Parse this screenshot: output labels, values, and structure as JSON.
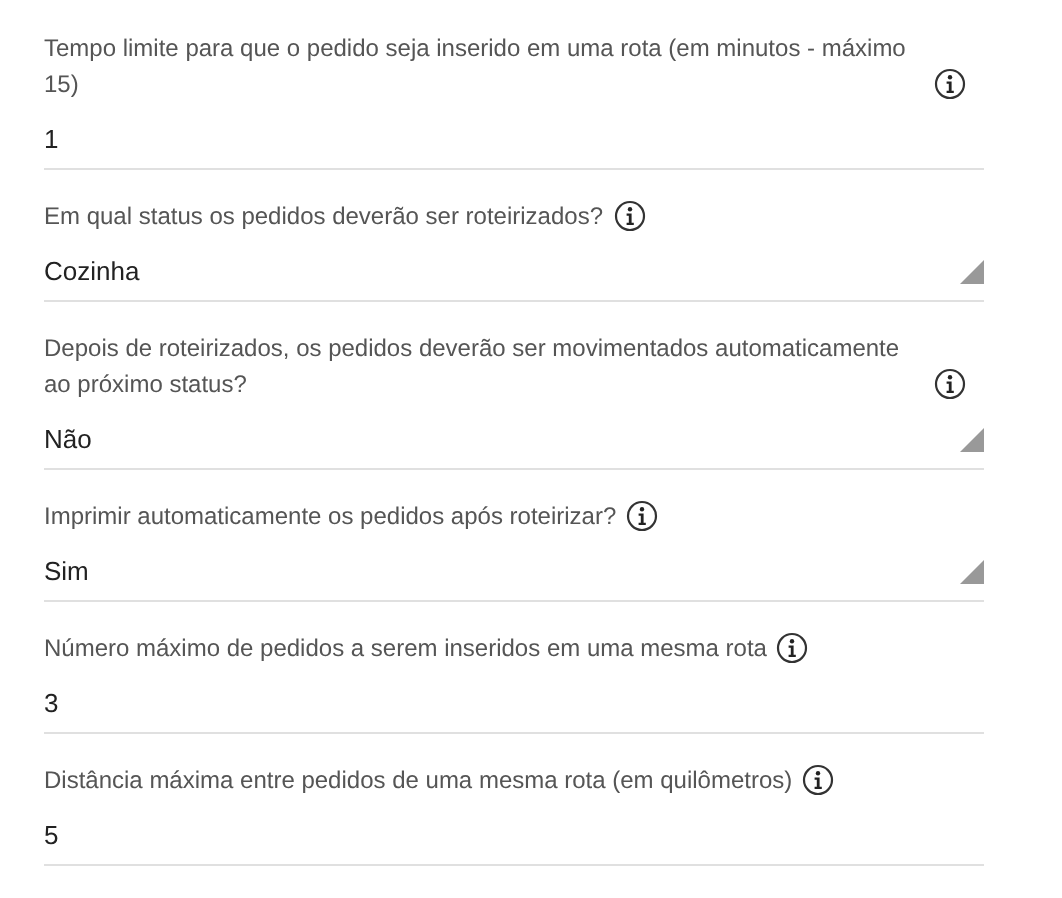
{
  "fields": [
    {
      "kind": "text",
      "label": "Tempo limite para que o pedido seja inserido em uma rota (em minutos - máximo 15)",
      "value": "1"
    },
    {
      "kind": "select",
      "label": "Em qual status os pedidos deverão ser roteirizados?",
      "value": "Cozinha"
    },
    {
      "kind": "select",
      "label": "Depois de roteirizados, os pedidos deverão ser movimentados automaticamente ao próximo status?",
      "value": "Não"
    },
    {
      "kind": "select",
      "label": "Imprimir automaticamente os pedidos após roteirizar?",
      "value": "Sim"
    },
    {
      "kind": "text",
      "label": "Número máximo de pedidos a serem inseridos em uma mesma rota",
      "value": "3"
    },
    {
      "kind": "text",
      "label": "Distância máxima entre pedidos de uma mesma rota (em quilômetros)",
      "value": "5"
    }
  ]
}
